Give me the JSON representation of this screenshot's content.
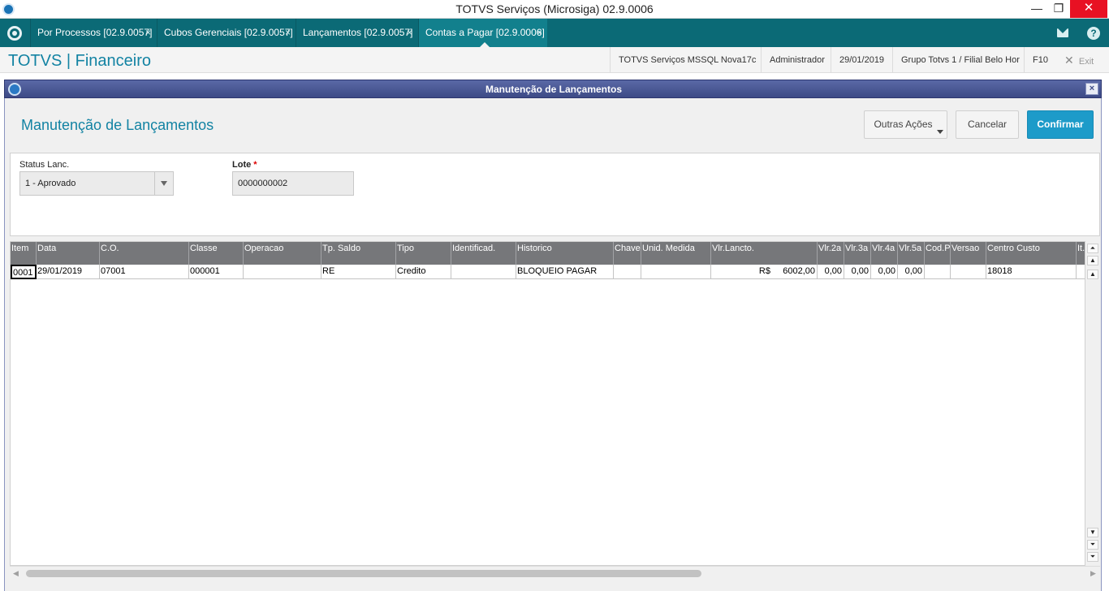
{
  "window": {
    "title": "TOTVS Serviços (Microsiga) 02.9.0006",
    "minimize": "—",
    "restore": "❐",
    "close": "✕"
  },
  "tabs": [
    {
      "label": "Por Processos [02.9.0057]",
      "close": "×"
    },
    {
      "label": "Cubos Gerenciais [02.9.0057]",
      "close": "×"
    },
    {
      "label": "Lançamentos [02.9.0057]",
      "close": "×"
    },
    {
      "label": "Contas a Pagar [02.9.0006]",
      "close": "×"
    }
  ],
  "header": {
    "brand": "TOTVS | Financeiro",
    "environment": "TOTVS Serviços MSSQL Nova17c",
    "user": "Administrador",
    "date": "29/01/2019",
    "branch": "Grupo Totvs 1 / Filial Belo Hor",
    "shortcut": "F10",
    "exit": "Exit",
    "help": "?"
  },
  "dialog": {
    "title": "Manutenção de Lançamentos",
    "close": "×",
    "page_title": "Manutenção de Lançamentos",
    "buttons": {
      "other_actions": "Outras Ações",
      "cancel": "Cancelar",
      "confirm": "Confirmar"
    }
  },
  "form": {
    "status_label": "Status Lanc.",
    "status_value": "1 - Aprovado",
    "lote_label": "Lote",
    "lote_required": "*",
    "lote_value": "0000000002"
  },
  "grid": {
    "columns": [
      "Item",
      "Data",
      "C.O.",
      "Classe",
      "Operacao",
      "Tp. Saldo",
      "Tipo",
      "Identificad.",
      "Historico",
      "Chave",
      "Unid. Medida",
      "Vlr.Lancto.",
      "Vlr.2a",
      "Vlr.3a",
      "Vlr.4a",
      "Vlr.5a",
      "Cod.Pl",
      "Versao",
      "Centro Custo",
      "It.C"
    ],
    "rows": [
      [
        "0001",
        "29/01/2019",
        "07001",
        "000001",
        "",
        "RE",
        "Credito",
        "",
        "BLOQUEIO PAGAR",
        "",
        "",
        "R$     6002,00",
        "0,00",
        "0,00",
        "0,00",
        "0,00",
        "",
        "",
        "18018",
        ""
      ]
    ]
  },
  "scroll": {
    "top": "⏶",
    "up": "▲",
    "up2": "▲",
    "down": "▼",
    "down2": "⏷",
    "bottom": "⏷",
    "left": "◀",
    "right": "▶"
  }
}
